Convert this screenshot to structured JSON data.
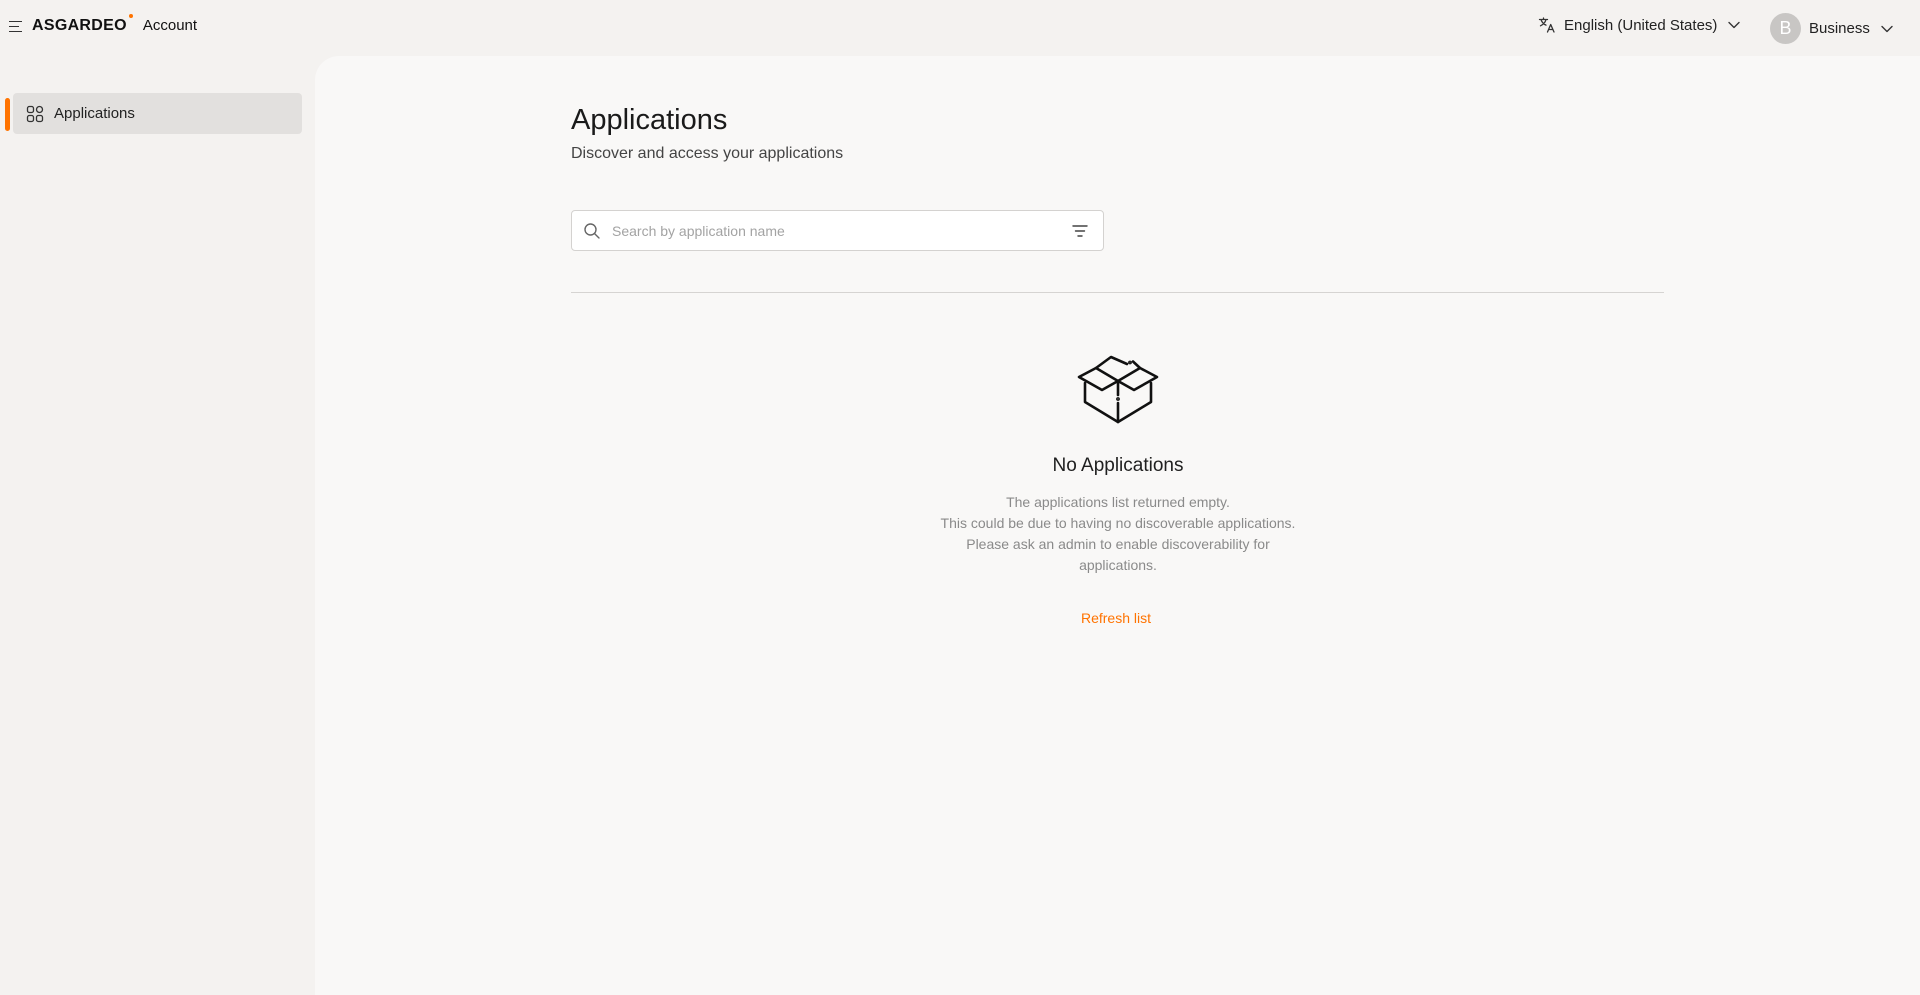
{
  "header": {
    "brand_logo": "ASGARDEO",
    "brand_product": "Account",
    "language_label": "English (United States)",
    "user_initial": "B",
    "user_name": "Business",
    "accent_color": "#ff7300"
  },
  "sidebar": {
    "items": [
      {
        "label": "Applications",
        "icon": "grid-apps-icon",
        "active": true
      }
    ]
  },
  "main": {
    "title": "Applications",
    "subtitle": "Discover and access your applications",
    "search": {
      "placeholder": "Search by application name",
      "value": ""
    },
    "empty_state": {
      "icon": "open-box-icon",
      "title": "No Applications",
      "description_lines": [
        "The applications list returned empty.",
        "This could be due to having no discoverable applications.",
        "Please ask an admin to enable discoverability for",
        "applications."
      ],
      "action_label": "Refresh list"
    }
  }
}
